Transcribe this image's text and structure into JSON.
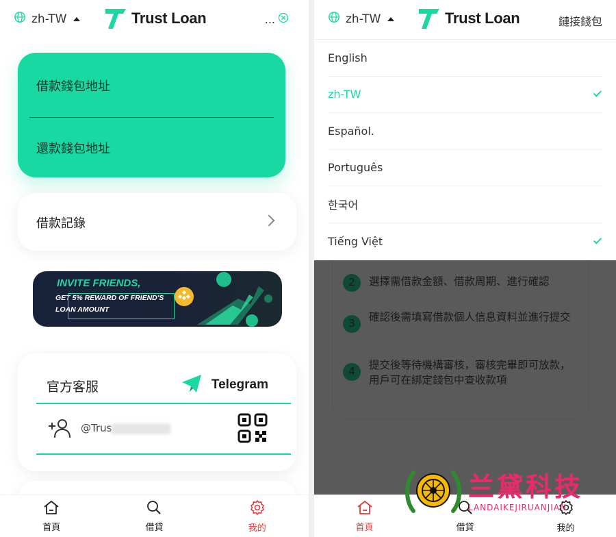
{
  "left": {
    "header": {
      "lang": "zh-TW",
      "brand": "Trust Loan",
      "right_ellipsis": "..."
    },
    "wallet": {
      "borrow_address": "借款錢包地址",
      "repay_address": "還款錢包地址"
    },
    "records": {
      "label": "借款記錄"
    },
    "banner": {
      "title": "INVITE FRIENDS,",
      "line1": "GET 5% REWARD OF FRIEND'S",
      "line2": "LOAN AMOUNT"
    },
    "service": {
      "title": "官方客服",
      "telegram": "Telegram",
      "handle": "@Trus"
    },
    "nav": [
      {
        "label": "首頁",
        "icon": "home-icon"
      },
      {
        "label": "借貸",
        "icon": "search-icon"
      },
      {
        "label": "我的",
        "icon": "settings-icon",
        "active": true
      }
    ]
  },
  "right": {
    "header": {
      "lang": "zh-TW",
      "brand": "Trust Loan",
      "connect": "鏈接錢包"
    },
    "languages": [
      {
        "label": "English",
        "selected": false,
        "checked": false
      },
      {
        "label": "zh-TW",
        "selected": true,
        "checked": true
      },
      {
        "label": "Español.",
        "selected": false,
        "checked": false
      },
      {
        "label": "Português",
        "selected": false,
        "checked": false
      },
      {
        "label": "한국어",
        "selected": false,
        "checked": false
      },
      {
        "label": "Tiếng Việt",
        "selected": false,
        "checked": true
      }
    ],
    "steps": [
      {
        "num": "2",
        "text": "選擇需借款金額、借款周期、進行確認"
      },
      {
        "num": "3",
        "text": "確認後需填寫借款個人信息資料並進行提交"
      },
      {
        "num": "4",
        "text": "提交後等待機構審核，審核完畢即可放款，用戶可在綁定錢包中查收款項"
      }
    ],
    "nav": [
      {
        "label": "首頁",
        "icon": "home-icon",
        "active": true
      },
      {
        "label": "借貸",
        "icon": "search-icon"
      },
      {
        "label": "我的",
        "icon": "settings-icon"
      }
    ]
  },
  "watermark": {
    "name": "兰黛科技",
    "sub": "LANDAIKEJIRUANJIAN"
  },
  "colors": {
    "accent": "#19d9a3",
    "active_nav": "#e43b3b",
    "overlay": "#5a5a5a"
  }
}
